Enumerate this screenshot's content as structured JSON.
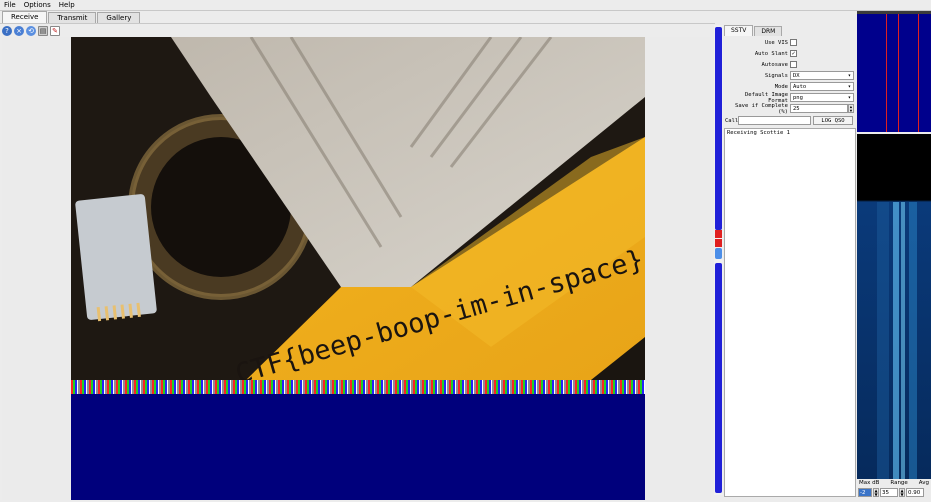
{
  "menu": [
    "File",
    "Options",
    "Help"
  ],
  "main_tabs": [
    "Receive",
    "Transmit",
    "Gallery"
  ],
  "active_main_tab": "Receive",
  "toolbar": {
    "icons": [
      "start-icon",
      "stop-icon",
      "reset-icon",
      "save-icon",
      "pen-icon"
    ]
  },
  "image": {
    "flag_text": "CTF{beep-boop-im-in-space}"
  },
  "panel": {
    "tabs": [
      "SSTV",
      "DRM"
    ],
    "active_tab": "SSTV",
    "use_vis_label": "Use VIS",
    "auto_slant_label": "Auto Slant",
    "autosave_label": "Autosave",
    "auto_slant_check": "✓",
    "signals_label": "Signals",
    "signals_value": "DX",
    "mode_label": "Mode",
    "mode_value": "Auto",
    "format_label": "Default Image Format",
    "format_value": "png",
    "save_label": "Save if Complete (%)",
    "save_value": "25",
    "call_label": "Call:",
    "log_button": "LOG QSO",
    "log_text": "Receiving Scottie 1"
  },
  "spectrum": {
    "labels": [
      "Max dB",
      "Range",
      "Avg"
    ],
    "max_db": "-2",
    "range": "35",
    "avg": "0.90"
  }
}
